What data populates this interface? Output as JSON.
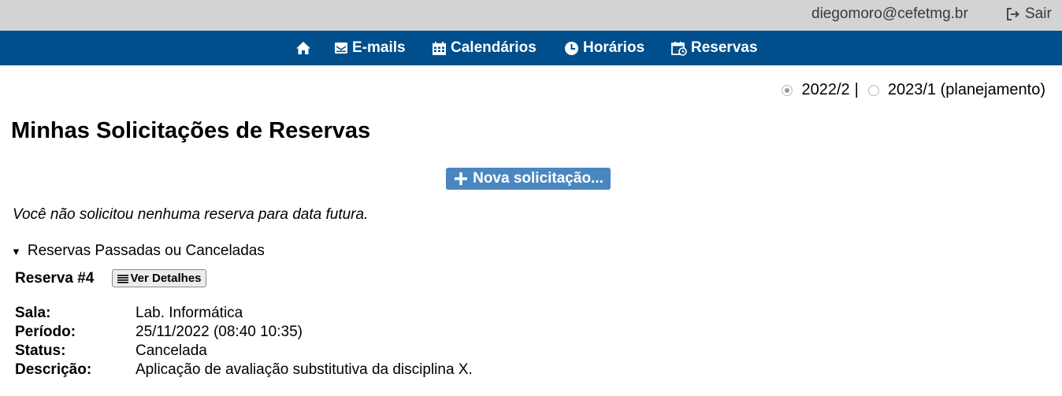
{
  "topbar": {
    "user_email": "diegomoro@cefetmg.br",
    "logout_label": "Sair",
    "background": "#d3d3d3"
  },
  "nav": {
    "background": "#004f8c",
    "items": [
      {
        "label": "",
        "icon": "home-icon"
      },
      {
        "label": "E-mails",
        "icon": "envelope-icon"
      },
      {
        "label": "Calendários",
        "icon": "calendar-icon"
      },
      {
        "label": "Horários",
        "icon": "clock-icon"
      },
      {
        "label": "Reservas",
        "icon": "calendar-clock-icon"
      }
    ]
  },
  "semester": {
    "options": [
      {
        "label": "2022/2",
        "selected": true
      },
      {
        "label": "2023/1 (planejamento)",
        "selected": false
      }
    ],
    "separator": "|"
  },
  "page": {
    "title": "Minhas Solicitações de Reservas",
    "new_button": "Nova solicitação...",
    "new_button_color": "#4a87c0",
    "empty_message": "Você não solicitou nenhuma reserva para data futura.",
    "past_section": "Reservas Passadas ou Canceladas"
  },
  "reservation": {
    "title": "Reserva #4",
    "details_button": "Ver Detalhes",
    "fields": [
      {
        "label": "Sala:",
        "value": "Lab. Informática"
      },
      {
        "label": "Período:",
        "value": "25/11/2022 (08:40 10:35)"
      },
      {
        "label": "Status:",
        "value": "Cancelada"
      },
      {
        "label": "Descrição:",
        "value": "Aplicação de avaliação substitutiva da disciplina X."
      }
    ]
  }
}
